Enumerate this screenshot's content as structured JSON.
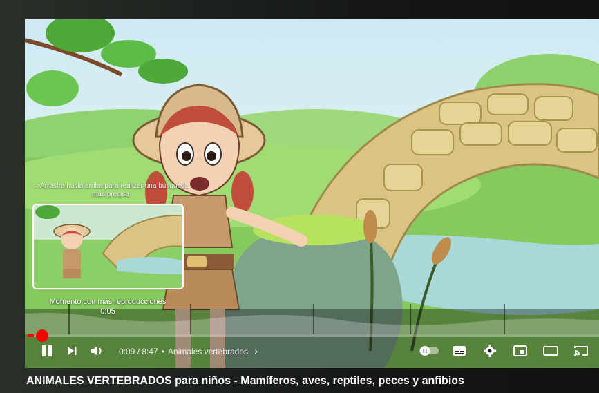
{
  "player": {
    "drag_hint": "☆ Arrastra hacia arriba para realizar una búsqueda más precisa",
    "most_replayed_label": "Momento con más reproducciones",
    "preview_time": "0:05",
    "progress_fraction": 0.011,
    "current_time": "0:09",
    "duration": "8:47",
    "time_separator": " / ",
    "chapter": "Animales vertebrados",
    "chapter_chevron": "›",
    "accent_color": "#ff0000",
    "icons": {
      "play_pause": "pause-icon",
      "next": "next-icon",
      "volume": "volume-icon",
      "autoplay": "autoplay-toggle-icon",
      "subtitles": "subtitles-icon",
      "settings": "gear-icon",
      "miniplayer": "miniplayer-icon",
      "theater": "theater-mode-icon",
      "cast": "cast-icon"
    }
  },
  "video": {
    "title": "ANIMALES VERTEBRADOS para niños - Mamíferos, aves, reptiles, peces y anfibios"
  }
}
